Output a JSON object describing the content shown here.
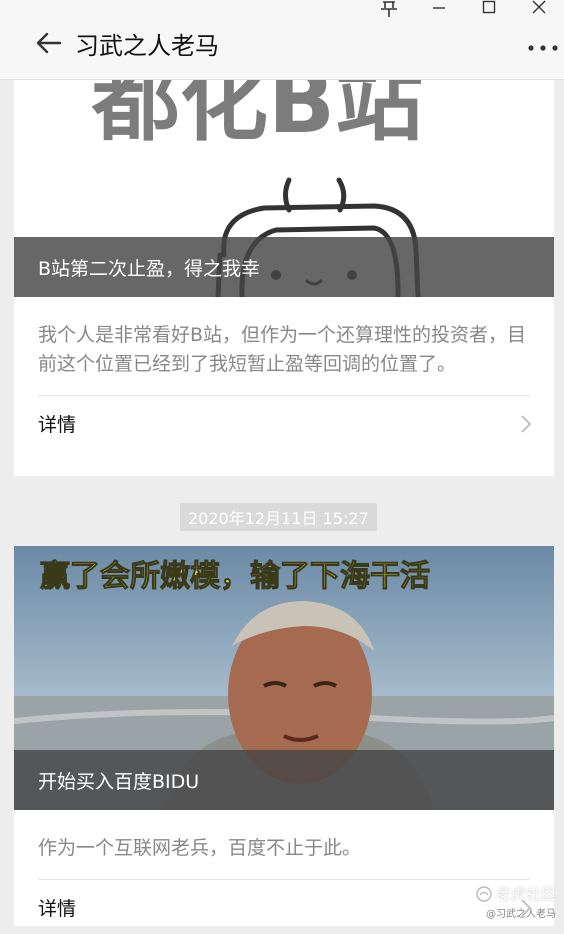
{
  "window": {
    "pin_icon": "pin-icon",
    "minimize_icon": "minimize-icon",
    "maximize_icon": "maximize-icon",
    "close_icon": "close-icon"
  },
  "header": {
    "title": "习武之人老马",
    "back_icon": "back-arrow-icon",
    "more_icon": "more-dots-icon"
  },
  "articles": [
    {
      "title": "B站第二次止盈，得之我幸",
      "image_text": "都化B站",
      "description": "我个人是非常看好B站，但作为一个还算理性的投资者，目前这个位置已经到了我短暂止盈等回调的位置了。",
      "details_label": "详情"
    },
    {
      "timestamp": "2020年12月11日 15:27",
      "image_caption": "赢了会所嫩模，输了下海干活",
      "title": "开始买入百度BIDU",
      "description": "作为一个互联网老兵，百度不止于此。",
      "details_label": "详情"
    }
  ],
  "watermark": {
    "line1": "老虎社区",
    "line2": "@习武之人老马"
  }
}
